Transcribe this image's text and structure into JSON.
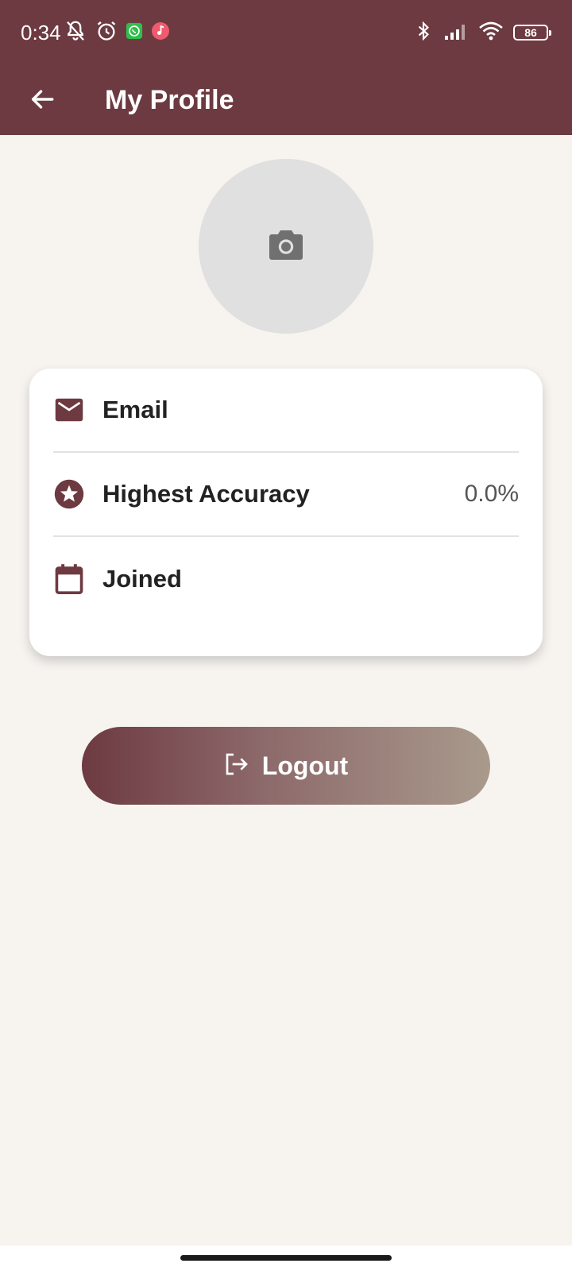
{
  "status_bar": {
    "time": "0:34",
    "battery_level": "86",
    "left_icons": [
      "muted-bell-icon",
      "alarm-icon",
      "whatsapp-icon",
      "music-app-icon"
    ],
    "right_icons": [
      "bluetooth-icon",
      "signal-icon",
      "wifi-icon",
      "battery-icon"
    ]
  },
  "app_bar": {
    "title": "My Profile",
    "back_icon": "arrow-left-icon"
  },
  "avatar": {
    "icon": "camera-icon"
  },
  "info_card": {
    "rows": [
      {
        "icon": "email-icon",
        "label": "Email",
        "value": ""
      },
      {
        "icon": "star-circle-icon",
        "label": "Highest Accuracy",
        "value": "0.0%"
      },
      {
        "icon": "calendar-icon",
        "label": "Joined",
        "value": ""
      }
    ]
  },
  "logout": {
    "label": "Logout",
    "icon": "logout-icon"
  },
  "colors": {
    "primary": "#6d3a41",
    "background": "#f7f4f0",
    "card": "#ffffff",
    "avatar_bg": "#e0e0e0",
    "gradient_end": "#a99a8c"
  }
}
